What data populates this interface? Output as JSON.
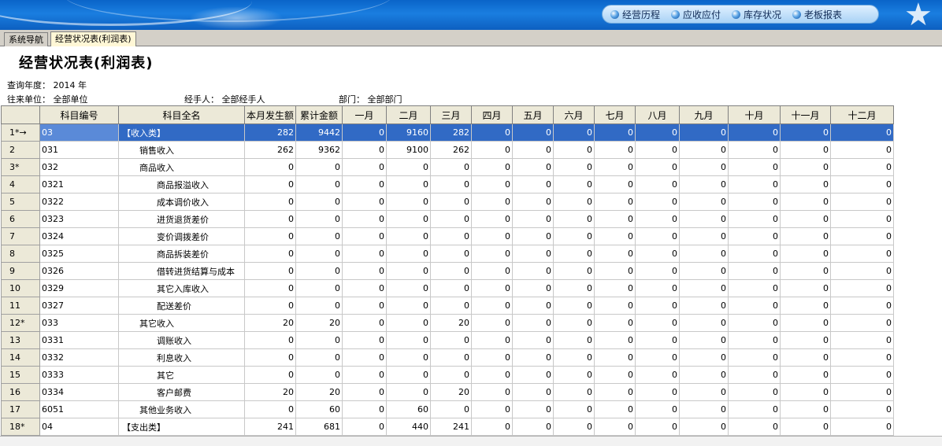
{
  "header": {
    "nav": [
      "经营历程",
      "应收应付",
      "库存状况",
      "老板报表"
    ],
    "colors": {
      "banner": "#0a64c8",
      "selected_row": "#316ac5"
    }
  },
  "tabs": [
    {
      "label": "系统导航",
      "active": false
    },
    {
      "label": "经营状况表(利润表)",
      "active": true
    }
  ],
  "page_title": "经营状况表(利润表)",
  "filters": {
    "year_label": "查询年度：",
    "year_value": "2014 年",
    "unit_label": "往来单位：",
    "unit_value": "全部单位",
    "handler_label": "经手人：",
    "handler_value": "全部经手人",
    "dept_label": "部门：",
    "dept_value": "全部部门"
  },
  "table": {
    "columns": [
      "科目编号",
      "科目全名",
      "本月发生额",
      "累计金额",
      "一月",
      "二月",
      "三月",
      "四月",
      "五月",
      "六月",
      "七月",
      "八月",
      "九月",
      "十月",
      "十一月",
      "十二月"
    ],
    "rows": [
      {
        "rn": "1*→",
        "code": "03",
        "name": "【收入类】",
        "indent": 0,
        "vals": [
          "282",
          "9442",
          "0",
          "9160",
          "282",
          "0",
          "0",
          "0",
          "0",
          "0",
          "0",
          "0",
          "0",
          "0"
        ],
        "selected": true
      },
      {
        "rn": "2",
        "code": "031",
        "name": "销售收入",
        "indent": 1,
        "vals": [
          "262",
          "9362",
          "0",
          "9100",
          "262",
          "0",
          "0",
          "0",
          "0",
          "0",
          "0",
          "0",
          "0",
          "0"
        ]
      },
      {
        "rn": "3*",
        "code": "032",
        "name": "商品收入",
        "indent": 1,
        "vals": [
          "0",
          "0",
          "0",
          "0",
          "0",
          "0",
          "0",
          "0",
          "0",
          "0",
          "0",
          "0",
          "0",
          "0"
        ]
      },
      {
        "rn": "4",
        "code": "0321",
        "name": "商品报溢收入",
        "indent": 2,
        "vals": [
          "0",
          "0",
          "0",
          "0",
          "0",
          "0",
          "0",
          "0",
          "0",
          "0",
          "0",
          "0",
          "0",
          "0"
        ]
      },
      {
        "rn": "5",
        "code": "0322",
        "name": "成本调价收入",
        "indent": 2,
        "vals": [
          "0",
          "0",
          "0",
          "0",
          "0",
          "0",
          "0",
          "0",
          "0",
          "0",
          "0",
          "0",
          "0",
          "0"
        ]
      },
      {
        "rn": "6",
        "code": "0323",
        "name": "进货退货差价",
        "indent": 2,
        "vals": [
          "0",
          "0",
          "0",
          "0",
          "0",
          "0",
          "0",
          "0",
          "0",
          "0",
          "0",
          "0",
          "0",
          "0"
        ]
      },
      {
        "rn": "7",
        "code": "0324",
        "name": "变价调拨差价",
        "indent": 2,
        "vals": [
          "0",
          "0",
          "0",
          "0",
          "0",
          "0",
          "0",
          "0",
          "0",
          "0",
          "0",
          "0",
          "0",
          "0"
        ]
      },
      {
        "rn": "8",
        "code": "0325",
        "name": "商品拆装差价",
        "indent": 2,
        "vals": [
          "0",
          "0",
          "0",
          "0",
          "0",
          "0",
          "0",
          "0",
          "0",
          "0",
          "0",
          "0",
          "0",
          "0"
        ]
      },
      {
        "rn": "9",
        "code": "0326",
        "name": "借转进货结算与成本",
        "indent": 2,
        "vals": [
          "0",
          "0",
          "0",
          "0",
          "0",
          "0",
          "0",
          "0",
          "0",
          "0",
          "0",
          "0",
          "0",
          "0"
        ]
      },
      {
        "rn": "10",
        "code": "0329",
        "name": "其它入库收入",
        "indent": 2,
        "vals": [
          "0",
          "0",
          "0",
          "0",
          "0",
          "0",
          "0",
          "0",
          "0",
          "0",
          "0",
          "0",
          "0",
          "0"
        ]
      },
      {
        "rn": "11",
        "code": "0327",
        "name": "配送差价",
        "indent": 2,
        "vals": [
          "0",
          "0",
          "0",
          "0",
          "0",
          "0",
          "0",
          "0",
          "0",
          "0",
          "0",
          "0",
          "0",
          "0"
        ]
      },
      {
        "rn": "12*",
        "code": "033",
        "name": "其它收入",
        "indent": 1,
        "vals": [
          "20",
          "20",
          "0",
          "0",
          "20",
          "0",
          "0",
          "0",
          "0",
          "0",
          "0",
          "0",
          "0",
          "0"
        ]
      },
      {
        "rn": "13",
        "code": "0331",
        "name": "调账收入",
        "indent": 2,
        "vals": [
          "0",
          "0",
          "0",
          "0",
          "0",
          "0",
          "0",
          "0",
          "0",
          "0",
          "0",
          "0",
          "0",
          "0"
        ]
      },
      {
        "rn": "14",
        "code": "0332",
        "name": "利息收入",
        "indent": 2,
        "vals": [
          "0",
          "0",
          "0",
          "0",
          "0",
          "0",
          "0",
          "0",
          "0",
          "0",
          "0",
          "0",
          "0",
          "0"
        ]
      },
      {
        "rn": "15",
        "code": "0333",
        "name": "其它",
        "indent": 2,
        "vals": [
          "0",
          "0",
          "0",
          "0",
          "0",
          "0",
          "0",
          "0",
          "0",
          "0",
          "0",
          "0",
          "0",
          "0"
        ]
      },
      {
        "rn": "16",
        "code": "0334",
        "name": "客户邮费",
        "indent": 2,
        "vals": [
          "20",
          "20",
          "0",
          "0",
          "20",
          "0",
          "0",
          "0",
          "0",
          "0",
          "0",
          "0",
          "0",
          "0"
        ]
      },
      {
        "rn": "17",
        "code": "6051",
        "name": "其他业务收入",
        "indent": 1,
        "vals": [
          "0",
          "60",
          "0",
          "60",
          "0",
          "0",
          "0",
          "0",
          "0",
          "0",
          "0",
          "0",
          "0",
          "0"
        ]
      },
      {
        "rn": "18*",
        "code": "04",
        "name": "【支出类】",
        "indent": 0,
        "vals": [
          "241",
          "681",
          "0",
          "440",
          "241",
          "0",
          "0",
          "0",
          "0",
          "0",
          "0",
          "0",
          "0",
          "0"
        ]
      }
    ]
  }
}
